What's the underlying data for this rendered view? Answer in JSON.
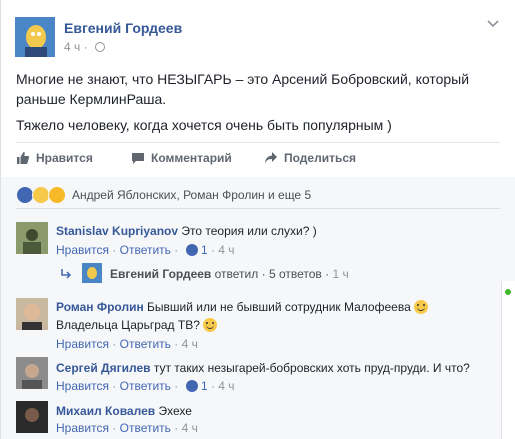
{
  "post": {
    "author": "Евгений Гордеев",
    "time": "4 ч",
    "privacy_icon": "globe-icon",
    "menu_icon": "chevron-down-icon",
    "text_line1": "Многие не знают, что НЕЗЫГАРЬ – это Арсений Бобровский, который",
    "text_line2": "раньше КермлинРаша.",
    "text_line3": "Тяжело человеку, когда хочется очень быть популярным )"
  },
  "actions": {
    "like": "Нравится",
    "comment": "Комментарий",
    "share": "Поделиться"
  },
  "reactions": {
    "icons": [
      "like-reaction-icon",
      "wow-reaction-icon",
      "haha-reaction-icon"
    ],
    "summary": "Андрей Яблонских, Роман Фролин и еще 5"
  },
  "comments": [
    {
      "author": "Stanislav Kupriyanov",
      "text": " Это теория или слухи? )",
      "like": "Нравится",
      "reply": "Ответить",
      "likes_count": "1",
      "time": "4 ч"
    },
    {
      "author": "Роман Фролин",
      "text_line1": " Бывший или не бывший сотрудник Малофеева",
      "text_line2": "Владельца Царьград ТВ?",
      "like": "Нравится",
      "reply": "Ответить",
      "time": "4 ч"
    },
    {
      "author": "Сергей Дягилев",
      "text": " тут таких незыгарей-бобровских хоть пруд-пруди. И что?",
      "like": "Нравится",
      "reply": "Ответить",
      "likes_count": "1",
      "time": "4 ч"
    },
    {
      "author": "Михаил Ковалев",
      "text": " Эхехе",
      "like": "Нравится",
      "reply": "Ответить",
      "time": "4 ч"
    }
  ],
  "reply_thread": {
    "author": "Евгений Гордеев",
    "answered": " ответил",
    "count": "5 ответов",
    "time": "1 ч"
  },
  "separator": " · ",
  "colors": {
    "link": "#365899",
    "meta": "#90949c",
    "accent": "#4267b2"
  }
}
